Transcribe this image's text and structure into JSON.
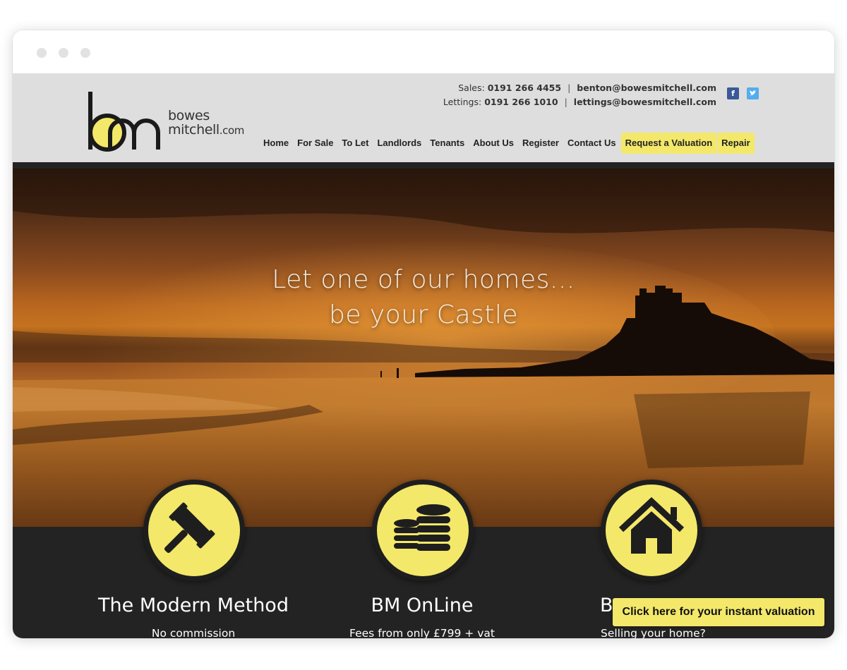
{
  "header": {
    "logo_line1": "bowes",
    "logo_line2": "mitchell",
    "logo_line3": ".com",
    "sales_label": "Sales:",
    "sales_phone": "0191 266 4455",
    "sales_email": "benton@bowesmitchell.com",
    "lettings_label": "Lettings:",
    "lettings_phone": "0191 266 1010",
    "lettings_email": "lettings@bowesmitchell.com",
    "separator": "|",
    "social": [
      {
        "name": "facebook-icon",
        "glyph": "f"
      },
      {
        "name": "twitter-icon",
        "glyph": "t"
      }
    ]
  },
  "nav": {
    "items": [
      {
        "label": "Home"
      },
      {
        "label": "For Sale"
      },
      {
        "label": "To Let"
      },
      {
        "label": "Landlords"
      },
      {
        "label": "Tenants"
      },
      {
        "label": "About Us"
      },
      {
        "label": "Register"
      },
      {
        "label": "Contact Us"
      },
      {
        "label": "Request a Valuation"
      },
      {
        "label": "Repair"
      }
    ]
  },
  "hero": {
    "line1": "Let one of our homes...",
    "line2": "be your Castle"
  },
  "features": [
    {
      "icon": "gavel-icon",
      "title": "The Modern Method",
      "subtitle": "No commission"
    },
    {
      "icon": "coins-icon",
      "title": "BM OnLine",
      "subtitle": "Fees from only £799 + vat"
    },
    {
      "icon": "house-icon",
      "title": "B",
      "subtitle": "Selling your home?"
    }
  ],
  "cta": {
    "label": "Click here for your instant valuation"
  },
  "colors": {
    "accent": "#f3e86a",
    "dark": "#232323",
    "header_bg": "#dedede",
    "facebook": "#3b5998",
    "twitter": "#55acee"
  }
}
